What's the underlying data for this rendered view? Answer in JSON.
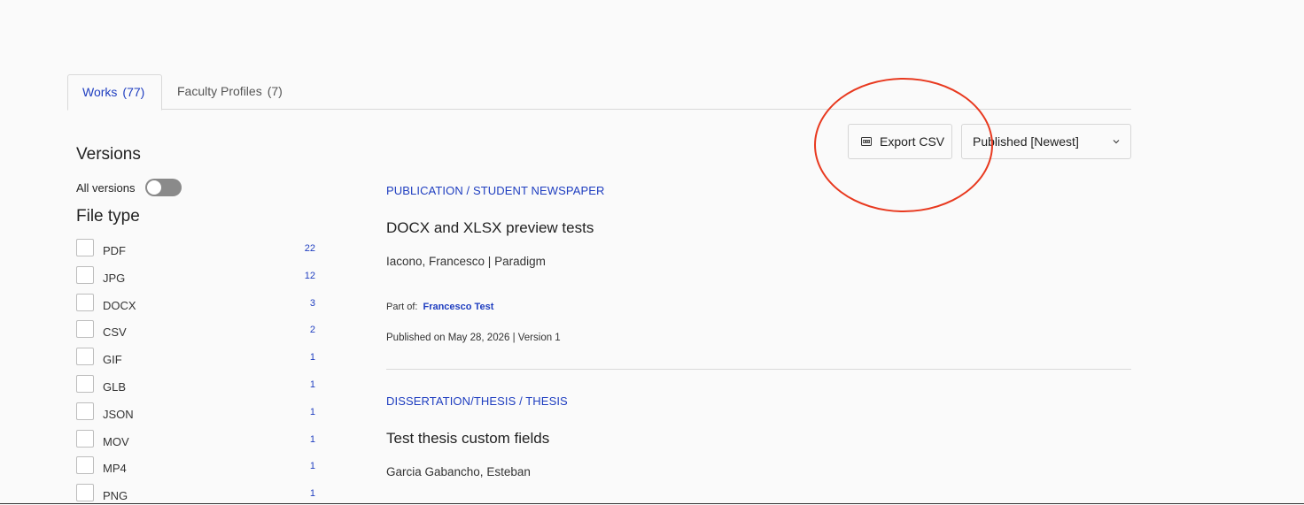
{
  "tabs": [
    {
      "label": "Works",
      "count": "(77)"
    },
    {
      "label": "Faculty Profiles",
      "count": "(7)"
    }
  ],
  "toolbar": {
    "export_label": "Export CSV",
    "export_icon": "csv-file-icon",
    "sort_value": "Published [Newest]"
  },
  "sidebar": {
    "versions_title": "Versions",
    "all_versions_label": "All versions",
    "file_type_title": "File type",
    "file_types": [
      {
        "label": "PDF",
        "count": "22"
      },
      {
        "label": "JPG",
        "count": "12"
      },
      {
        "label": "DOCX",
        "count": "3"
      },
      {
        "label": "CSV",
        "count": "2"
      },
      {
        "label": "GIF",
        "count": "1"
      },
      {
        "label": "GLB",
        "count": "1"
      },
      {
        "label": "JSON",
        "count": "1"
      },
      {
        "label": "MOV",
        "count": "1"
      },
      {
        "label": "MP4",
        "count": "1"
      },
      {
        "label": "PNG",
        "count": "1"
      }
    ]
  },
  "results": [
    {
      "type": "PUBLICATION / STUDENT NEWSPAPER",
      "title": "DOCX and XLSX preview tests",
      "authors": "Iacono, Francesco | Paradigm",
      "part_of_label": "Part of:",
      "part_of": "Francesco Test",
      "published": "Published on May 28, 2026 | Version 1"
    },
    {
      "type": "DISSERTATION/THESIS / THESIS",
      "title": "Test thesis custom fields",
      "authors": "Garcia Gabancho, Esteban"
    }
  ],
  "colors": {
    "accent": "#1f3ec0",
    "annotation": "#e8391f"
  }
}
